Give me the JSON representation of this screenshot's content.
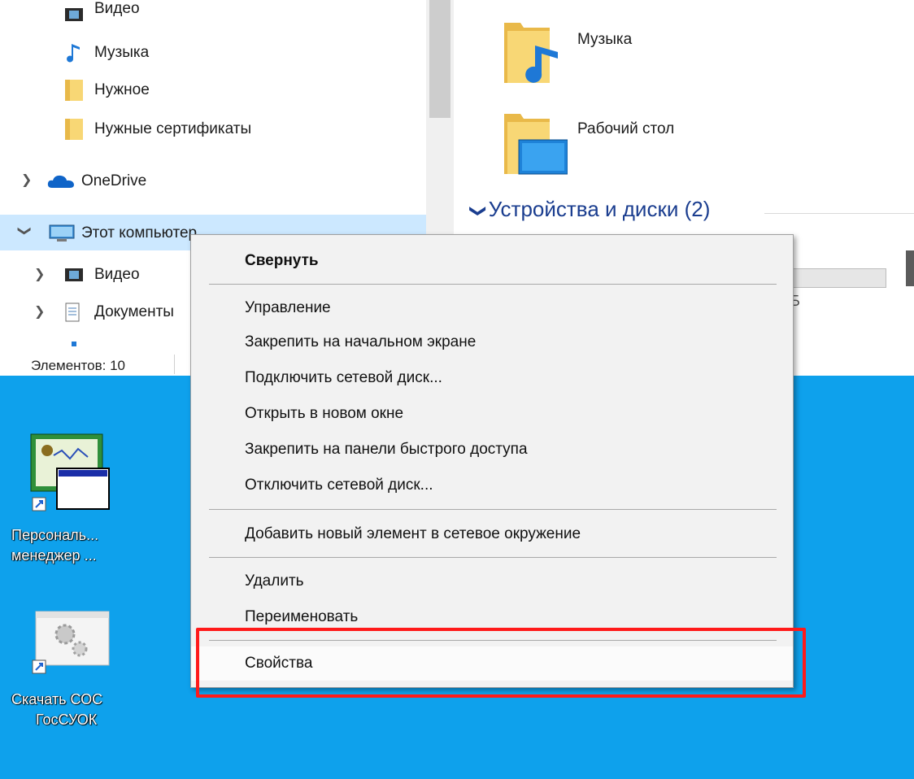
{
  "nav": {
    "items": [
      {
        "label": "Видео"
      },
      {
        "label": "Музыка"
      },
      {
        "label": "Нужное"
      },
      {
        "label": "Нужные сертификаты"
      },
      {
        "label": "OneDrive"
      },
      {
        "label": "Этот компьютер"
      },
      {
        "label": "Видео"
      },
      {
        "label": "Документы"
      }
    ]
  },
  "status": {
    "items_count": "Элементов: 10"
  },
  "content": {
    "folders": [
      {
        "name": "Музыка",
        "icon": "music-folder-icon"
      },
      {
        "name": "Рабочий стол",
        "icon": "desktop-folder-icon"
      }
    ],
    "group_title": "Устройства и диски (2)",
    "drive_partial_text": "Б"
  },
  "desktop": {
    "icons": [
      {
        "label_line1": "Персональ...",
        "label_line2": "менеджер ..."
      },
      {
        "label_line1": "Скачать СОС",
        "label_line2": "ГосСУОК"
      }
    ]
  },
  "menu": {
    "items": [
      {
        "label": "Свернуть"
      },
      {
        "label": "Управление"
      },
      {
        "label": "Закрепить на начальном экране"
      },
      {
        "label": "Подключить сетевой диск..."
      },
      {
        "label": "Открыть в новом окне"
      },
      {
        "label": "Закрепить на панели быстрого доступа"
      },
      {
        "label": "Отключить сетевой диск..."
      },
      {
        "label": "Добавить новый элемент в сетевое окружение"
      },
      {
        "label": "Удалить"
      },
      {
        "label": "Переименовать"
      },
      {
        "label": "Свойства"
      }
    ]
  },
  "colors": {
    "desktop_bg": "#0ea1ec",
    "selection": "#cce8ff",
    "highlight_frame": "#ff1a1a",
    "group_title": "#1a3d8f"
  }
}
